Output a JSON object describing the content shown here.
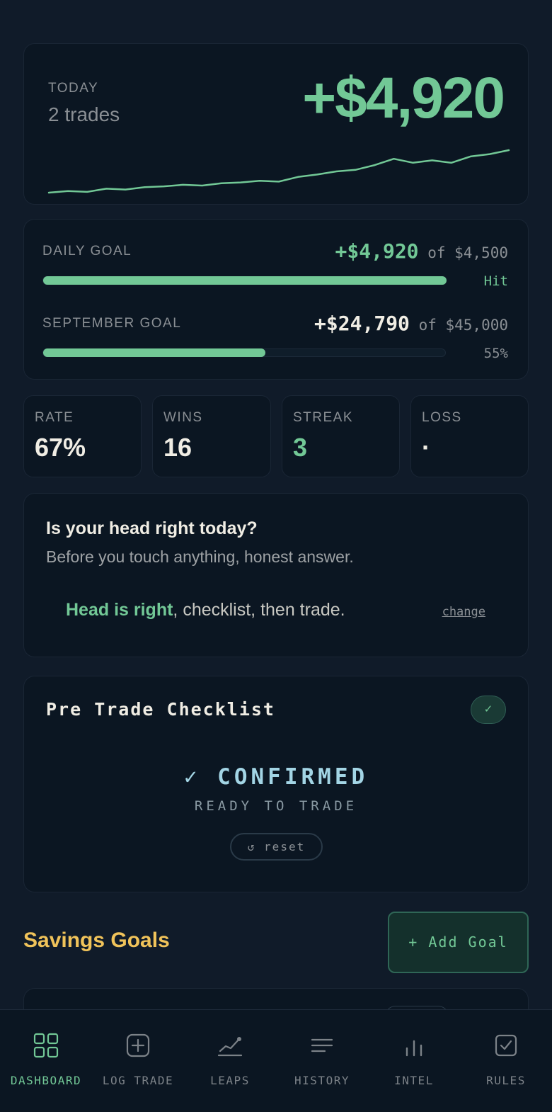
{
  "today": {
    "label": "TODAY",
    "trades": "2 trades",
    "pnl": "+$4,920",
    "sparkline": [
      0,
      2,
      1,
      5,
      4,
      7,
      8,
      10,
      9,
      12,
      13,
      15,
      14,
      20,
      23,
      27,
      29,
      35,
      43,
      38,
      41,
      38,
      46,
      49,
      54
    ]
  },
  "goals": {
    "daily": {
      "label": "DAILY GOAL",
      "amount": "+$4,920",
      "of": "of $4,500",
      "status": "Hit",
      "progress": 1.0
    },
    "month": {
      "label": "SEPTEMBER GOAL",
      "amount": "+$24,790",
      "of": "of $45,000",
      "status": "55%",
      "progress": 0.55
    }
  },
  "stats": [
    {
      "label": "RATE",
      "value": "67%"
    },
    {
      "label": "WINS",
      "value": "16"
    },
    {
      "label": "STREAK",
      "value": "3"
    },
    {
      "label": "LOSS",
      "value": "·"
    }
  ],
  "head": {
    "title": "Is your head right today?",
    "subtitle": "Before you touch anything, honest answer.",
    "status_highlight": "Head is right",
    "status_rest": ", checklist, then trade.",
    "change": "change"
  },
  "checklist": {
    "title": "Pre Trade Checklist",
    "badge": "✓",
    "confirmed": "✓ CONFIRMED",
    "ready": "READY TO TRADE",
    "reset": "↺ reset"
  },
  "savings": {
    "title": "Savings Goals",
    "add_button": "+ Add Goal"
  },
  "nav": [
    {
      "label": "DASHBOARD",
      "icon": "grid-icon",
      "active": true
    },
    {
      "label": "LOG TRADE",
      "icon": "plus-square-icon",
      "active": false
    },
    {
      "label": "LEAPS",
      "icon": "trend-line-icon",
      "active": false
    },
    {
      "label": "HISTORY",
      "icon": "list-lines-icon",
      "active": false
    },
    {
      "label": "INTEL",
      "icon": "bar-chart-icon",
      "active": false
    },
    {
      "label": "RULES",
      "icon": "checkbox-icon",
      "active": false
    }
  ],
  "colors": {
    "accent": "#72c896",
    "gold": "#f0c35a",
    "muted": "#8a8f94",
    "background": "#101b29",
    "card": "#0b1622"
  }
}
